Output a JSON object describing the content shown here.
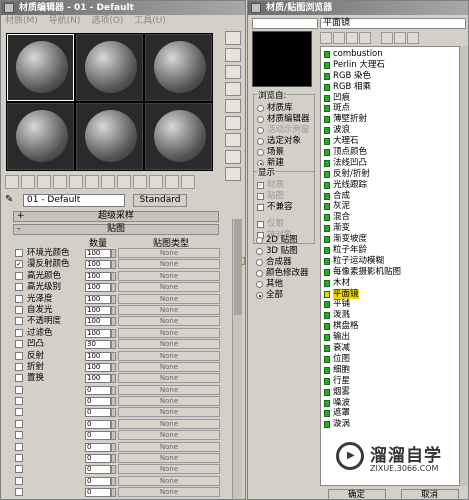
{
  "material_editor": {
    "title": "材质编辑器 - 01 - Default",
    "menu": [
      "材质(M)",
      "导航(N)",
      "选项(O)",
      "工具(U)"
    ],
    "material_name": "01 - Default",
    "material_type": "Standard",
    "rollout_supersampling": "超级采样",
    "rollout_maps": "贴图",
    "col_amount": "数量",
    "col_maptype": "贴图类型",
    "maps": [
      {
        "label": "环境光颜色",
        "amount": "100",
        "map": "None",
        "checked": false,
        "dim": false
      },
      {
        "label": "漫反射颜色",
        "amount": "100",
        "map": "None",
        "checked": true,
        "dim": false
      },
      {
        "label": "高光颜色",
        "amount": "100",
        "map": "None",
        "checked": false,
        "dim": false
      },
      {
        "label": "高光级别",
        "amount": "100",
        "map": "None",
        "checked": false,
        "dim": false
      },
      {
        "label": "光泽度",
        "amount": "100",
        "map": "None",
        "checked": false,
        "dim": false
      },
      {
        "label": "自发光",
        "amount": "100",
        "map": "None",
        "checked": false,
        "dim": false
      },
      {
        "label": "不透明度",
        "amount": "100",
        "map": "None",
        "checked": false,
        "dim": false
      },
      {
        "label": "过滤色",
        "amount": "100",
        "map": "None",
        "checked": false,
        "dim": false
      },
      {
        "label": "凹凸",
        "amount": "30",
        "map": "None",
        "checked": false,
        "dim": false
      },
      {
        "label": "反射",
        "amount": "100",
        "map": "None",
        "checked": false,
        "dim": false
      },
      {
        "label": "折射",
        "amount": "100",
        "map": "None",
        "checked": false,
        "dim": false
      },
      {
        "label": "置换",
        "amount": "100",
        "map": "None",
        "checked": false,
        "dim": false
      },
      {
        "label": "",
        "amount": "0",
        "map": "None",
        "checked": false,
        "dim": true
      },
      {
        "label": "",
        "amount": "0",
        "map": "None",
        "checked": false,
        "dim": true
      },
      {
        "label": "",
        "amount": "0",
        "map": "None",
        "checked": false,
        "dim": true
      },
      {
        "label": "",
        "amount": "0",
        "map": "None",
        "checked": false,
        "dim": true
      },
      {
        "label": "",
        "amount": "0",
        "map": "None",
        "checked": false,
        "dim": true
      },
      {
        "label": "",
        "amount": "0",
        "map": "None",
        "checked": false,
        "dim": true
      },
      {
        "label": "",
        "amount": "0",
        "map": "None",
        "checked": false,
        "dim": true
      },
      {
        "label": "",
        "amount": "0",
        "map": "None",
        "checked": false,
        "dim": true
      },
      {
        "label": "",
        "amount": "0",
        "map": "None",
        "checked": false,
        "dim": true
      },
      {
        "label": "",
        "amount": "0",
        "map": "None",
        "checked": false,
        "dim": true
      },
      {
        "label": "",
        "amount": "0",
        "map": "None",
        "checked": false,
        "dim": true
      },
      {
        "label": "",
        "amount": "0",
        "map": "None",
        "checked": false,
        "dim": true
      }
    ]
  },
  "map_browser": {
    "title": "材质/贴图浏览器",
    "selected_name": "平面镜",
    "browse_from_title": "浏览自:",
    "browse_from": [
      {
        "label": "材质库",
        "on": false,
        "dim": false
      },
      {
        "label": "材质编辑器",
        "on": false,
        "dim": false
      },
      {
        "label": "活动示例窗",
        "on": false,
        "dim": true
      },
      {
        "label": "选定对象",
        "on": false,
        "dim": false
      },
      {
        "label": "场景",
        "on": false,
        "dim": false
      },
      {
        "label": "新建",
        "on": true,
        "dim": false
      }
    ],
    "show_title": "显示",
    "show": [
      {
        "label": "材质",
        "checked": true,
        "dim": true
      },
      {
        "label": "贴图",
        "checked": true,
        "dim": true
      },
      {
        "label": "不兼容",
        "checked": false,
        "dim": false
      }
    ],
    "show2": [
      {
        "label": "仅根",
        "checked": false,
        "dim": true
      },
      {
        "label": "按对象",
        "checked": false,
        "dim": true
      }
    ],
    "categories": [
      {
        "label": "2D 贴图",
        "on": false
      },
      {
        "label": "3D 贴图",
        "on": false
      },
      {
        "label": "合成器",
        "on": false
      },
      {
        "label": "颜色修改器",
        "on": false
      },
      {
        "label": "其他",
        "on": false
      },
      {
        "label": "全部",
        "on": true
      }
    ],
    "maps": [
      "combustion",
      "Perlin 大理石",
      "RGB 染色",
      "RGB 相乘",
      "凹痕",
      "斑点",
      "薄壁折射",
      "波浪",
      "大理石",
      "顶点颜色",
      "法线凹凸",
      "反射/折射",
      "光线跟踪",
      "合成",
      "灰泥",
      "混合",
      "渐变",
      "渐变坡度",
      "粒子年龄",
      "粒子运动模糊",
      "每像素摄影机贴图",
      "木材",
      "平面镜",
      "平铺",
      "泼溅",
      "棋盘格",
      "输出",
      "衰减",
      "位图",
      "细胞",
      "行星",
      "烟雾",
      "噪波",
      "遮罩",
      "漩涡"
    ],
    "selected_index": 22,
    "ok": "确定",
    "cancel": "取消"
  },
  "watermark": {
    "name": "溜溜自学",
    "url": "ZIXUE.3066.COM"
  }
}
